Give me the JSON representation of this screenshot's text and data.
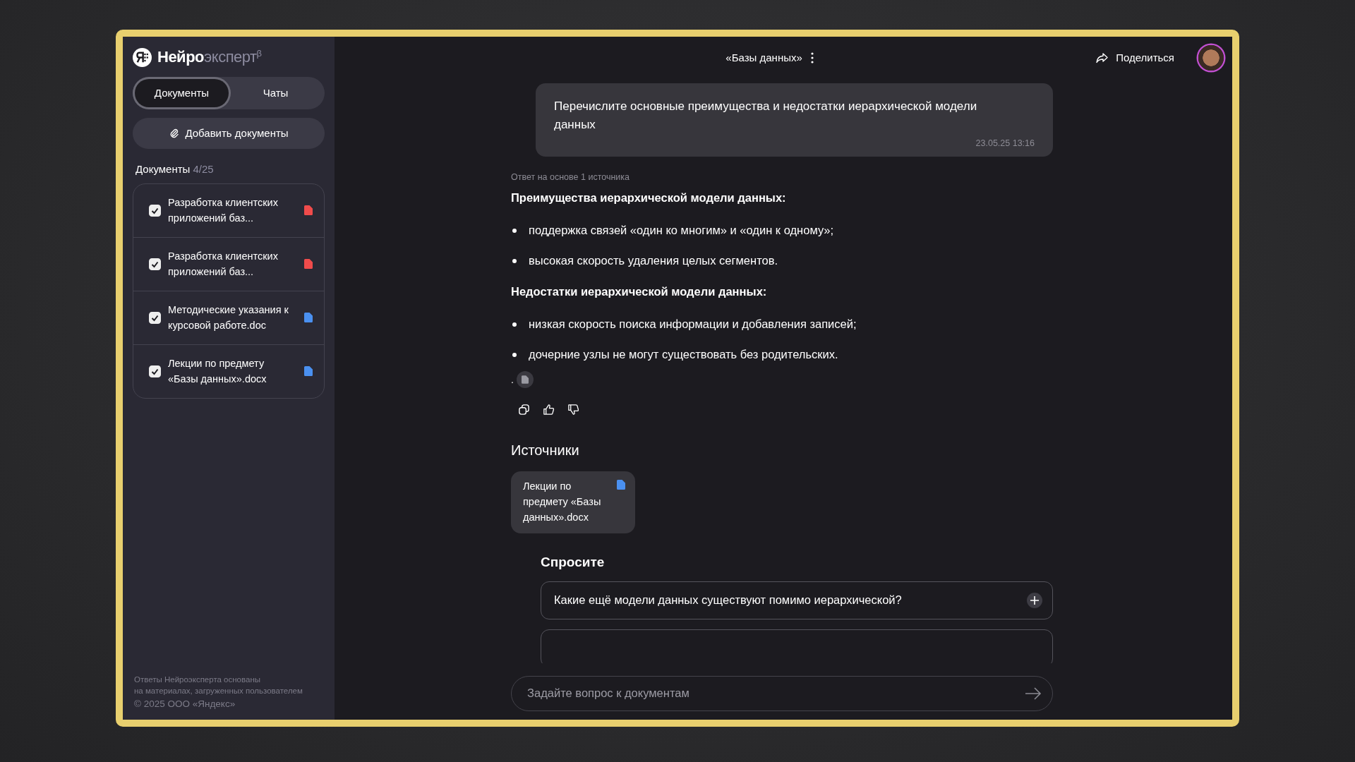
{
  "brand": {
    "strong": "Нейро",
    "light": "эксперт",
    "sup": "β"
  },
  "tabs": [
    {
      "label": "Документы",
      "selected": true
    },
    {
      "label": "Чаты",
      "selected": false
    }
  ],
  "add_button": "Добавить документы",
  "documents_header": {
    "label": "Документы",
    "count": "4/25"
  },
  "documents": [
    {
      "name": "Разработка клиентских приложений баз...",
      "checked": true,
      "color": "#f04b4b"
    },
    {
      "name": "Разработка клиентских приложений баз...",
      "checked": true,
      "color": "#f04b4b"
    },
    {
      "name": "Методические указания к курсовой работе.doc",
      "checked": true,
      "color": "#4a90f0"
    },
    {
      "name": "Лекции по предмету «Базы данных».docx",
      "checked": true,
      "color": "#4a90f0"
    }
  ],
  "footer": [
    "Ответы Нейроэксперта основаны",
    "на материалах, загруженных пользователем",
    "© 2025 ООО «Яндекс»"
  ],
  "header": {
    "title": "«Базы данных»",
    "share": "Поделиться"
  },
  "question": {
    "text": "Перечислите основные преимущества и недостатки иерархической модели данных",
    "time": "23.05.25 13:16"
  },
  "answer_source_note": "Ответ на основе 1 источника",
  "answer": [
    {
      "kind": "heading",
      "text": "Преимущества иерархической модели данных:"
    },
    {
      "kind": "bullet",
      "text": "поддержка связей «один ко многим» и «один к одному»;"
    },
    {
      "kind": "bullet",
      "text": "высокая скорость удаления целых сегментов."
    },
    {
      "kind": "heading",
      "text": "Недостатки иерархической модели данных:"
    },
    {
      "kind": "bullet",
      "text": "низкая скорость поиска информации и добавления записей;"
    },
    {
      "kind": "bullet",
      "text": "дочерние узлы не могут существовать без родительских."
    }
  ],
  "citation_dot": ".",
  "sources_title": "Источники",
  "sources": [
    {
      "name": "Лекции по предмету «Базы данных».docx",
      "color": "#4a90f0"
    }
  ],
  "suggestions_title": "Спросите",
  "suggestions": [
    "Какие ещё модели данных существуют помимо иерархической?"
  ],
  "input": {
    "placeholder": "Задайте вопрос к документам"
  }
}
